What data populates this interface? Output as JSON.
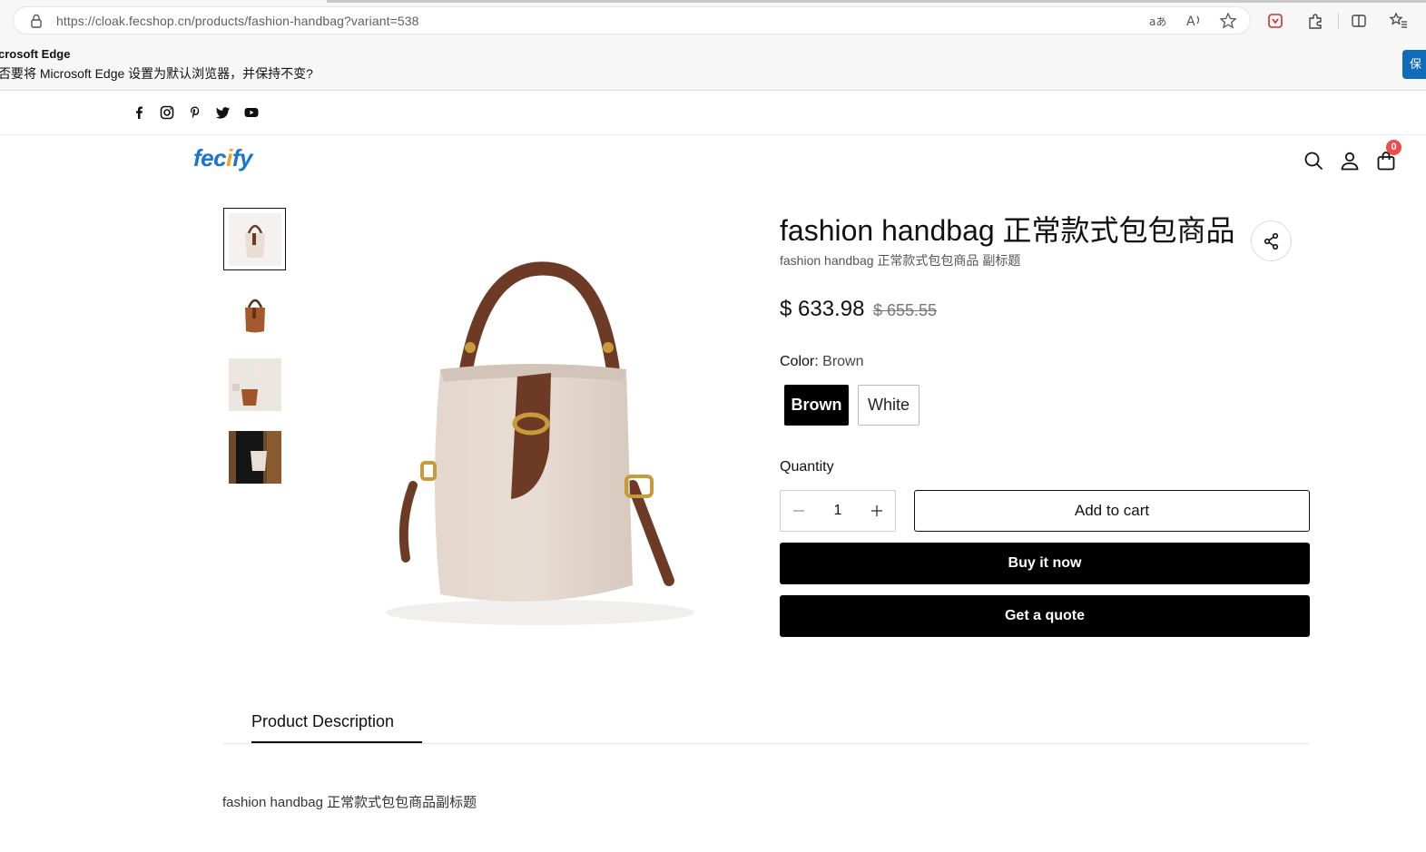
{
  "browser": {
    "url": "https://cloak.fecshop.cn/products/fashion-handbag?variant=538",
    "infobar_title": "crosoft Edge",
    "infobar_message": "否要将 Microsoft Edge 设置为默认浏览器，并保持不变?",
    "infobar_button": "保"
  },
  "social": [
    "facebook-icon",
    "instagram-icon",
    "pinterest-icon",
    "twitter-icon",
    "youtube-icon"
  ],
  "header": {
    "logo_main": "fec",
    "logo_accent": "i",
    "logo_tail": "fy",
    "cart_count": "0",
    "icons": [
      "search-icon",
      "account-icon",
      "cart-icon"
    ],
    "accent_color": "#1a74d1",
    "badge_color": "#ef4b4b"
  },
  "product": {
    "title": "fashion handbag 正常款式包包商品",
    "subtitle": "fashion handbag 正常款式包包商品 副标题",
    "price": "$ 633.98",
    "compare_price": "$ 655.55",
    "color_label": "Color:",
    "color_value": "Brown",
    "colors": [
      "Brown",
      "White"
    ],
    "selected_color": "Brown",
    "quantity_label": "Quantity",
    "quantity": "1",
    "add_to_cart": "Add to cart",
    "buy_now": "Buy it now",
    "get_quote": "Get a quote",
    "thumbnails": 4,
    "active_thumbnail": 1
  },
  "description": {
    "tab_label": "Product Description",
    "text": "fashion handbag 正常款式包包商品副标题"
  }
}
